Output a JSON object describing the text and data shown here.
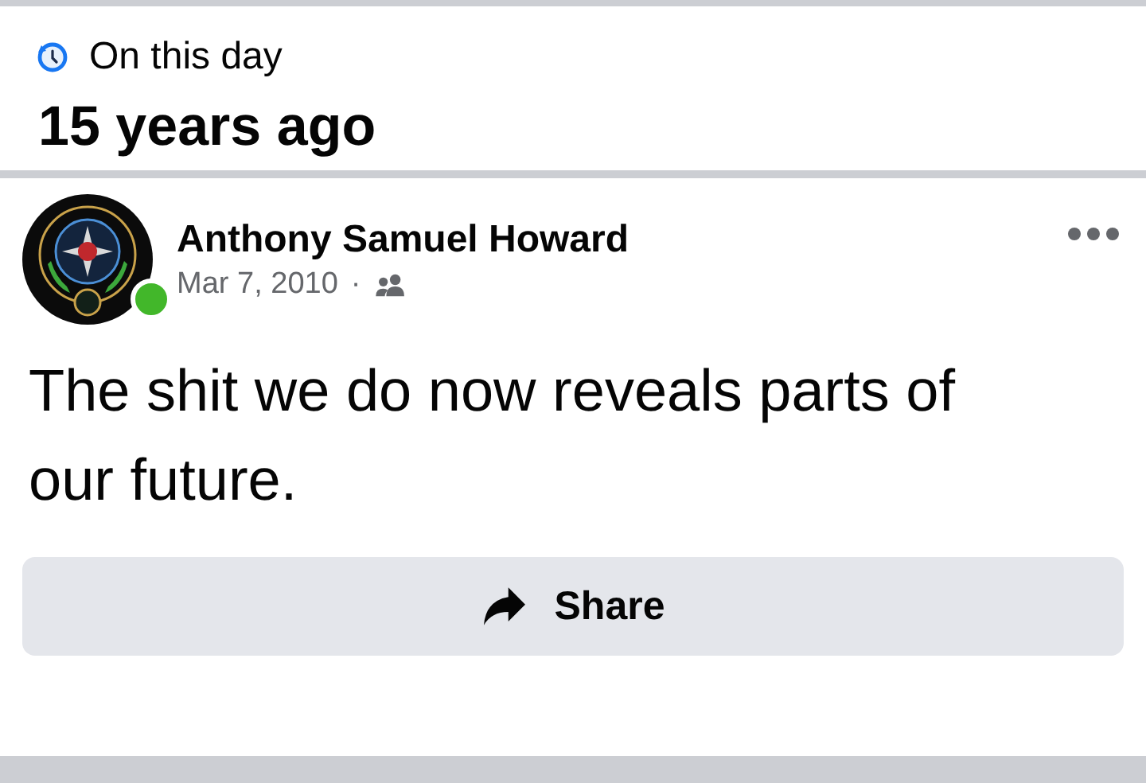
{
  "memory": {
    "label": "On this day",
    "title": "15 years ago"
  },
  "post": {
    "author": "Anthony Samuel Howard",
    "online": true,
    "date": "Mar 7, 2010",
    "separator": "·",
    "text": "The shit we do now reveals parts of our future."
  },
  "actions": [
    {
      "label": "Share",
      "kind": "share"
    }
  ]
}
